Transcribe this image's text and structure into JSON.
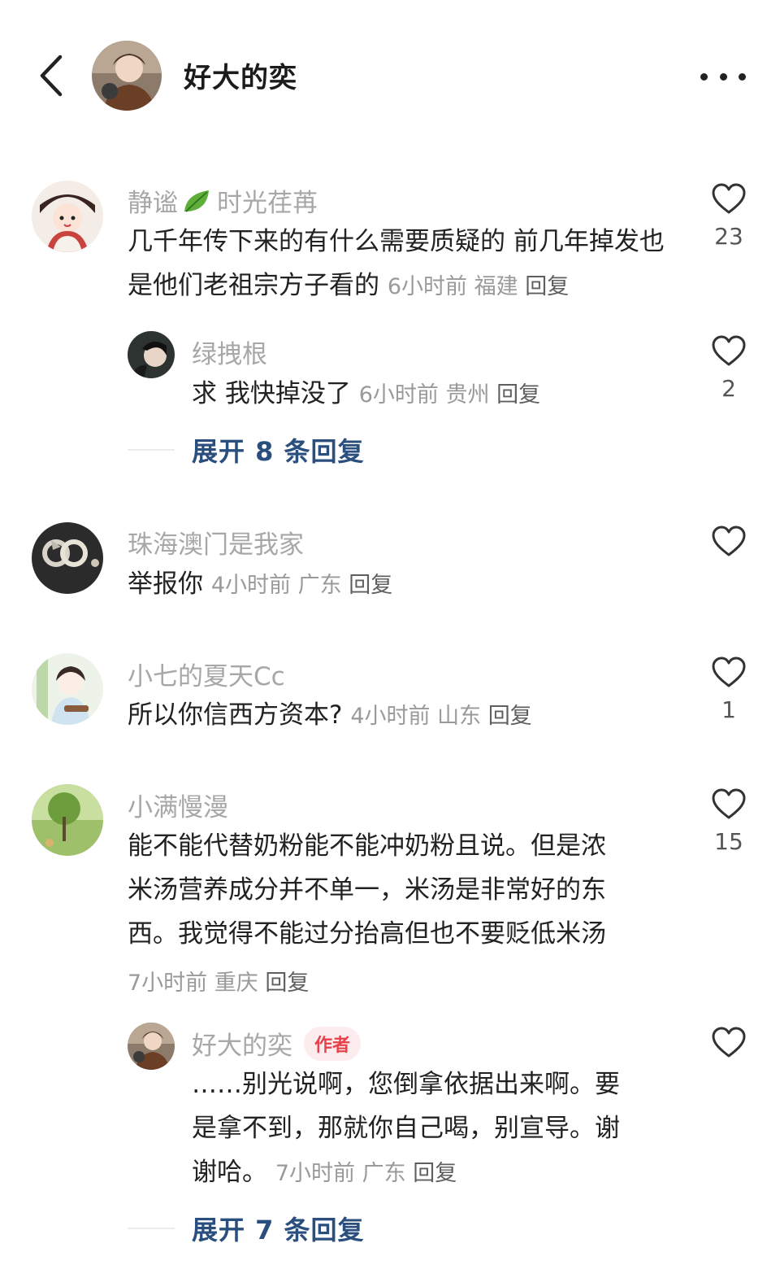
{
  "header": {
    "title": "好大的奕",
    "back_icon": "chevron-left-icon",
    "more_icon": "more-dots-icon"
  },
  "comments": [
    {
      "username_a": "静谧",
      "username_b": "时光荏苒",
      "text": "几千年传下来的有什么需要质疑的 前几年掉发也是他们老祖宗方子看的",
      "time": "6小时前",
      "location": "福建",
      "reply": "回复",
      "likes": "23",
      "replies": [
        {
          "username": "绿拽根",
          "text": "求 我快掉没了",
          "time": "6小时前",
          "location": "贵州",
          "reply": "回复",
          "likes": "2"
        }
      ],
      "expand_label": "展开 8 条回复"
    },
    {
      "username": "珠海澳门是我家",
      "text": "举报你",
      "time": "4小时前",
      "location": "广东",
      "reply": "回复",
      "likes": ""
    },
    {
      "username": "小七的夏天Cc",
      "text": "所以你信西方资本?",
      "time": "4小时前",
      "location": "山东",
      "reply": "回复",
      "likes": "1"
    },
    {
      "username": "小满慢漫",
      "text_lines": [
        "能不能代替奶粉能不能冲奶粉且说。但是浓",
        "米汤营养成分并不单一，米汤是非常好的东",
        "西。我觉得不能过分抬高但也不要贬低米汤"
      ],
      "time": "7小时前",
      "location": "重庆",
      "reply": "回复",
      "likes": "15",
      "replies": [
        {
          "username": "好大的奕",
          "badge": "作者",
          "text_lines": [
            "……别光说啊，您倒拿依据出来啊。要",
            "是拿不到，那就你自己喝，别宣导。谢",
            "谢哈。"
          ],
          "time": "7小时前",
          "location": "广东",
          "reply": "回复",
          "likes": ""
        }
      ],
      "expand_label": "展开 7 条回复"
    }
  ],
  "colors": {
    "username": "#a7a7a7",
    "text": "#222222",
    "meta": "#9a9a9a",
    "expand": "#2a4f7e",
    "badge_bg": "#fdeced",
    "badge_text": "#e8414b"
  },
  "icons": {
    "like": "heart-outline-icon",
    "leaf": "leaf-emoji-icon"
  }
}
